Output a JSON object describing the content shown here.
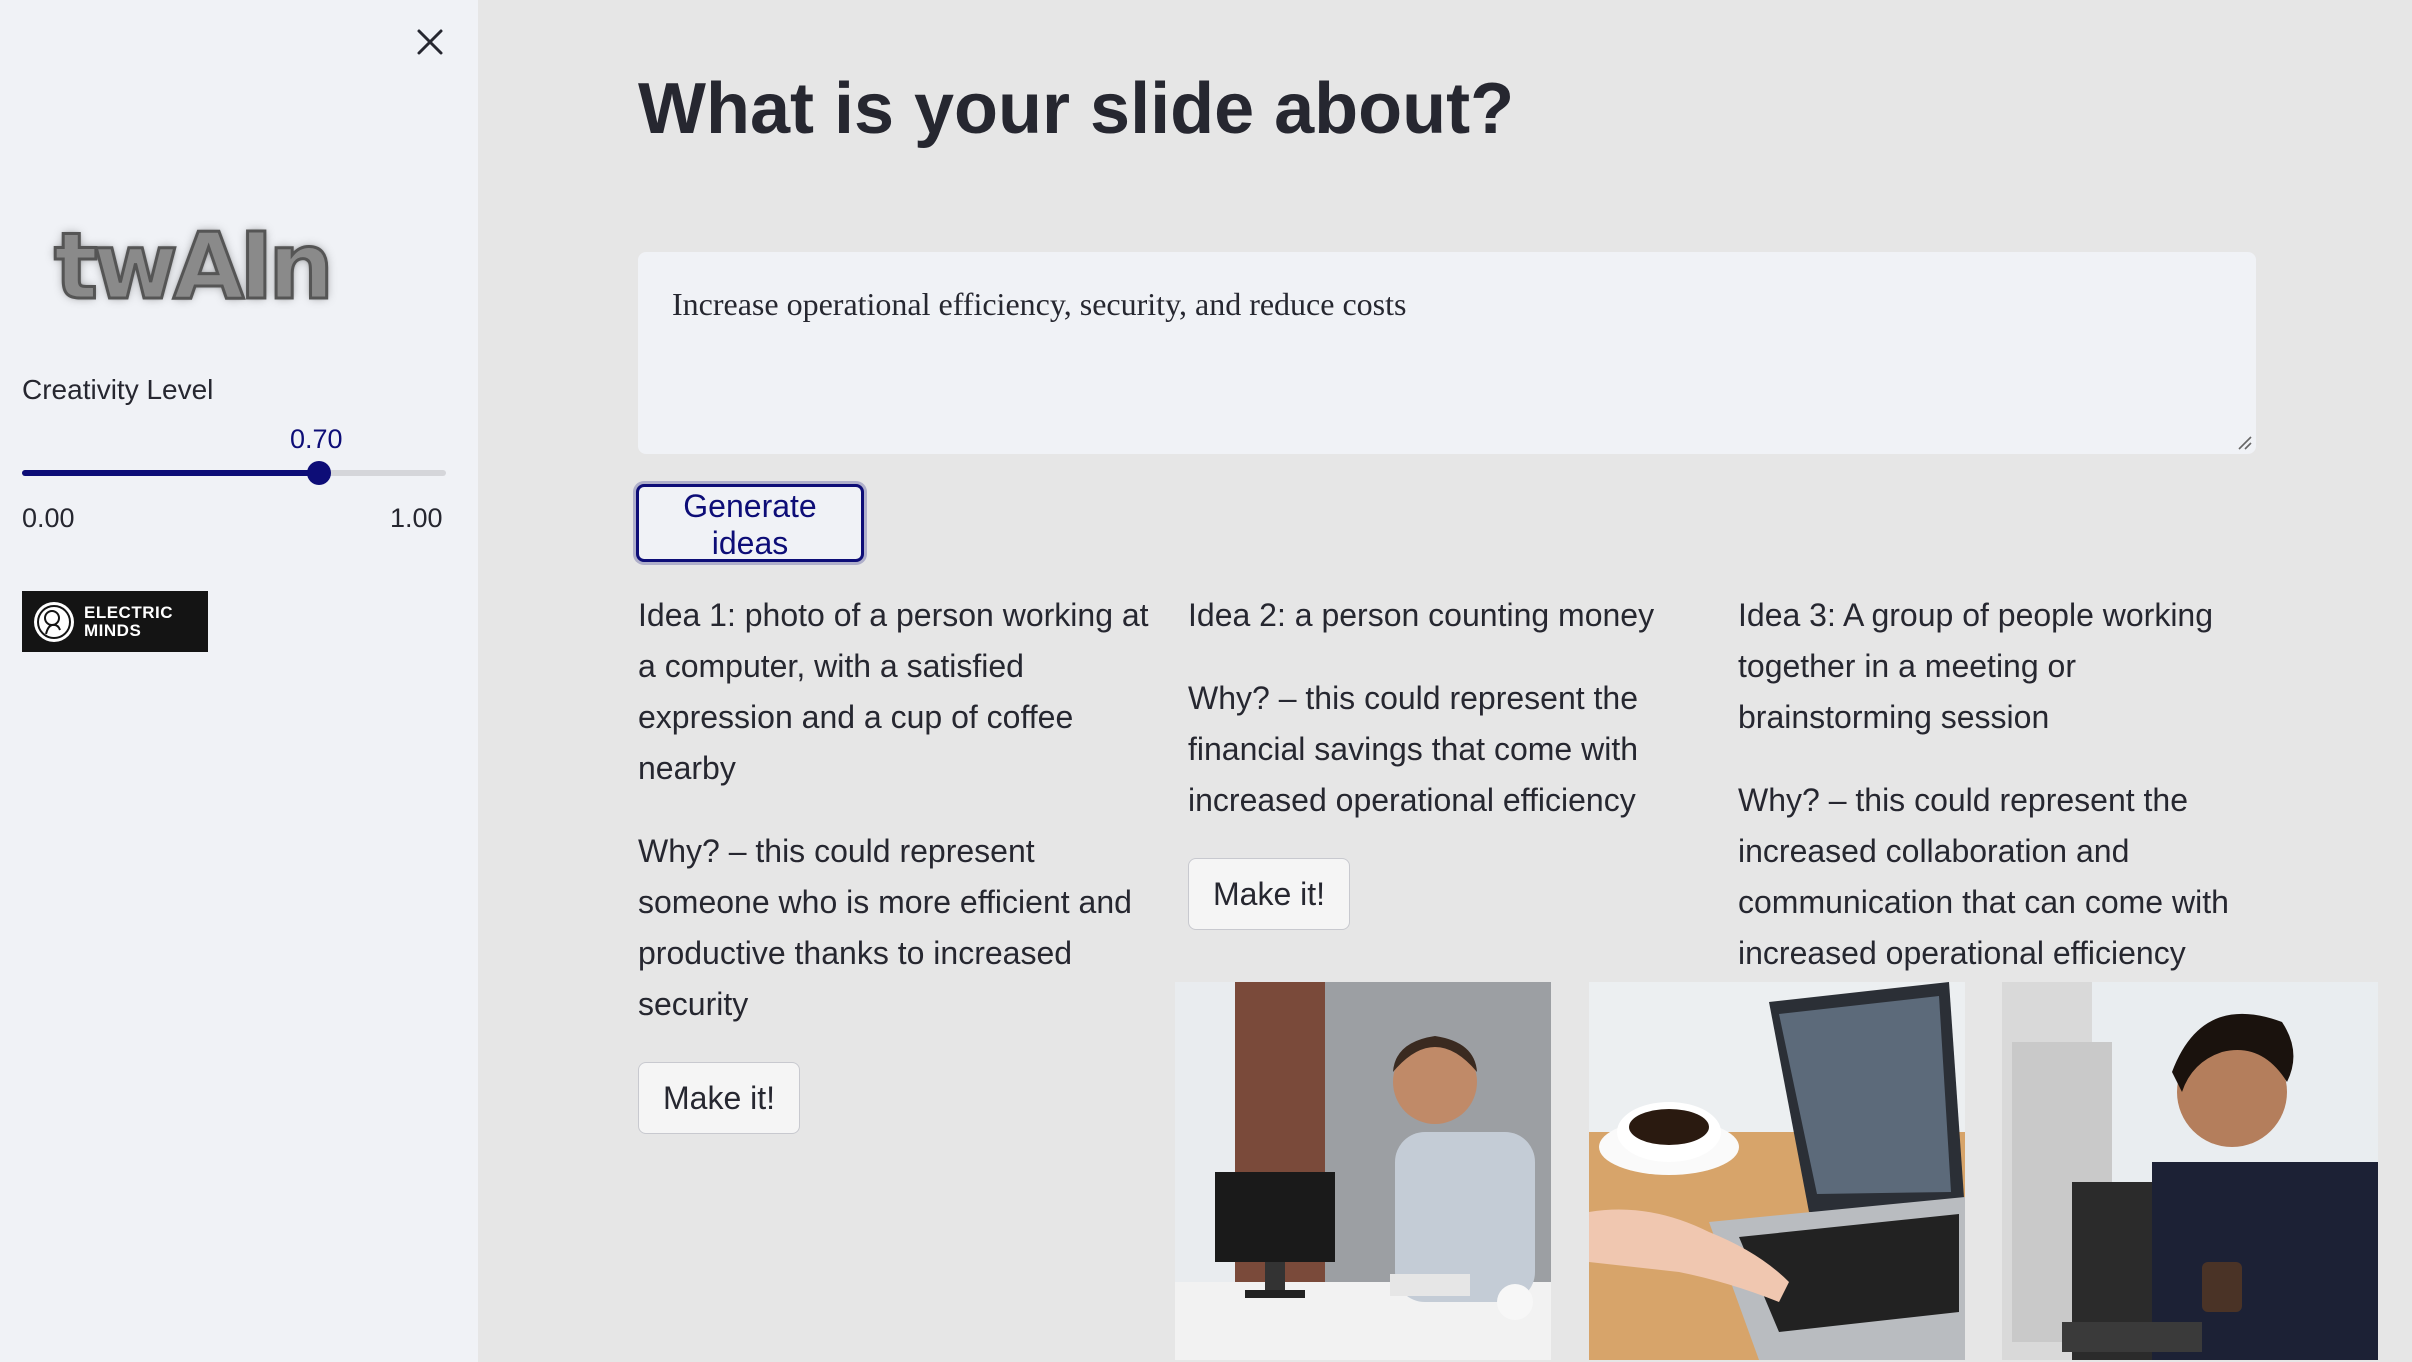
{
  "sidebar": {
    "logo_text": "twAIn",
    "slider": {
      "label": "Creativity Level",
      "value": 0.7,
      "value_text": "0.70",
      "min": "0.00",
      "max": "1.00"
    },
    "brand_badge": {
      "line1": "ELECTRIC",
      "line2": "MINDS"
    }
  },
  "main": {
    "title": "What is your slide about?",
    "topic_value": "Increase operational efficiency, security, and reduce costs",
    "generate_label": "Generate ideas",
    "ideas": [
      {
        "idea": "Idea 1: photo of a person working at a computer, with a satisfied expression and a cup of coffee nearby",
        "why": "Why? – this could represent someone who is more efficient and productive thanks to increased security",
        "button": "Make it!"
      },
      {
        "idea": "Idea 2: a person counting money",
        "why": "Why? – this could represent the financial savings that come with increased operational efficiency",
        "button": "Make it!"
      },
      {
        "idea": "Idea 3: A group of people working together in a meeting or brainstorming session",
        "why": "Why? – this could represent the increased collaboration and communication that can come with increased operational efficiency"
      }
    ]
  },
  "colors": {
    "accent": "#0d0d77",
    "sidebar_bg": "#f0f2f6",
    "main_bg": "#e6e6e6"
  }
}
